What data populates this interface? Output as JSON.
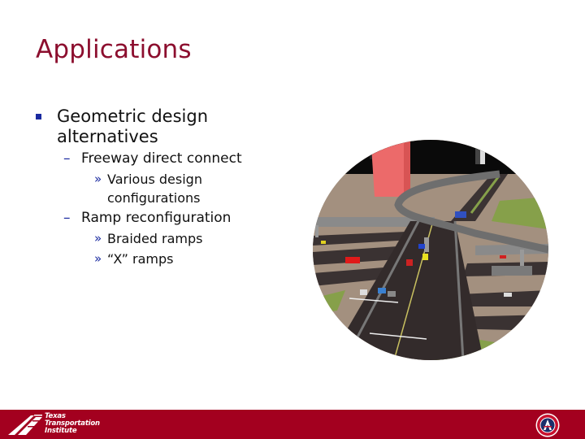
{
  "slide": {
    "title": "Applications",
    "bullets": [
      {
        "text": "Geometric design alternatives",
        "line1": "Geometric design",
        "line2": "alternatives",
        "children": [
          {
            "text": "Freeway direct connect",
            "children": [
              {
                "line1": "Various design",
                "line2": "configurations"
              }
            ]
          },
          {
            "text": "Ramp reconfiguration",
            "children": [
              {
                "line1": "Braided ramps"
              },
              {
                "line1": "“X” ramps"
              }
            ]
          }
        ]
      }
    ],
    "markers": {
      "level1": "square-bullet",
      "level2": "–",
      "level3": "»"
    },
    "image": {
      "subject": "3D freeway interchange rendering (circular crop)"
    }
  },
  "footer": {
    "left_logo": {
      "line1": "Texas",
      "line2": "Transportation",
      "line3": "Institute"
    },
    "right_logo": "university-of-arizona-seal"
  },
  "colors": {
    "title": "#8c0e2e",
    "bullet": "#1a2aa0",
    "footer_band": "#a3001f"
  }
}
